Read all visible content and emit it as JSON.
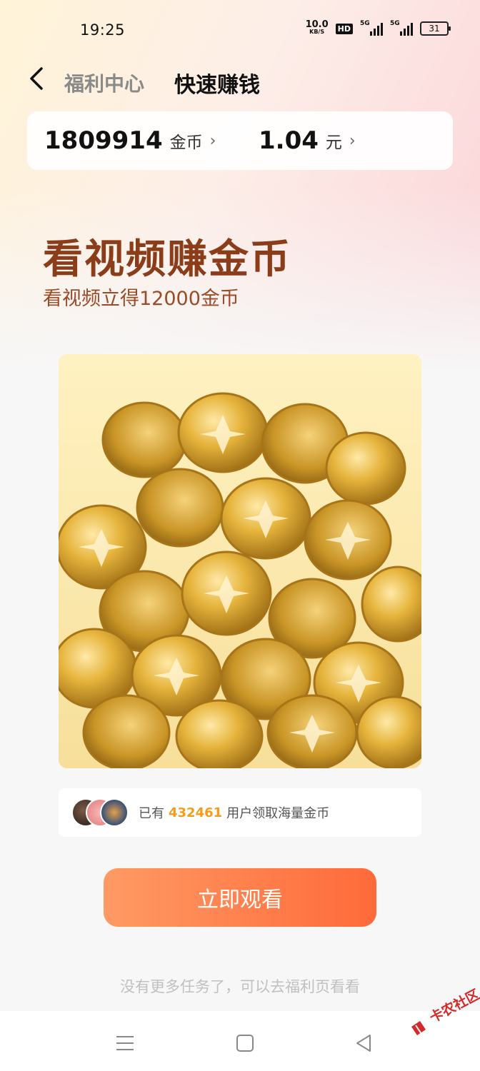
{
  "status_bar": {
    "time": "19:25",
    "net_speed_value": "10.0",
    "net_speed_unit": "KB/S",
    "hd_badge": "HD",
    "signal1_label": "5G",
    "signal2_label": "5G",
    "battery": "31"
  },
  "nav": {
    "tab_welfare": "福利中心",
    "tab_earn": "快速赚钱"
  },
  "balance": {
    "coins_value": "1809914",
    "coins_unit": "金币",
    "cash_value": "1.04",
    "cash_unit": "元",
    "chevron": "›"
  },
  "hero": {
    "title": "看视频赚金币",
    "subtitle": "看视频立得12000金币"
  },
  "users": {
    "prefix": "已有",
    "count": "432461",
    "suffix": "用户领取海量金币"
  },
  "cta": {
    "watch_label": "立即观看"
  },
  "footer": {
    "note": "没有更多任务了，可以去福利页看看"
  },
  "watermark": {
    "text": "卡农社区"
  },
  "colors": {
    "title": "#8b3d1a",
    "accent_orange": "#ff6a3a",
    "count_orange": "#f59c1a"
  }
}
